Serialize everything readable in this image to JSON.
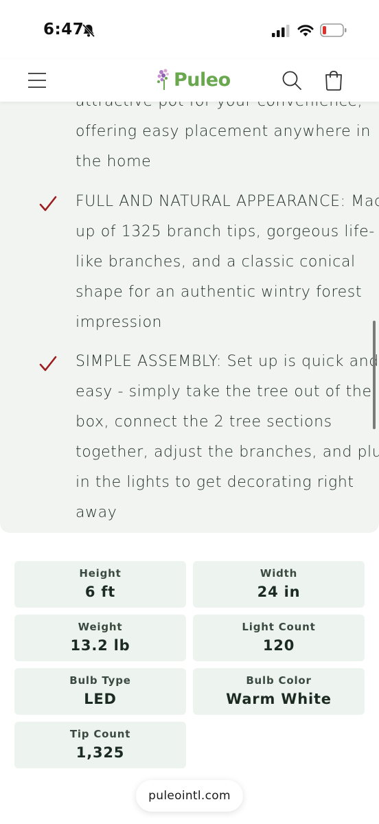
{
  "status_bar": {
    "time": "6:47"
  },
  "header": {
    "logo_text": "Puleo",
    "icons": [
      "menu-icon",
      "search-icon",
      "cart-icon"
    ]
  },
  "description": {
    "partial_lines": [
      "attractive pot for your convenience,",
      "offering easy placement anywhere in",
      "the home"
    ],
    "features": [
      {
        "lines": [
          "FULL AND NATURAL APPEARANCE: Made",
          "up of 1325 branch tips, gorgeous life-",
          "like branches, and a classic conical",
          "shape for an authentic wintry forest",
          "impression"
        ]
      },
      {
        "lines": [
          "SIMPLE ASSEMBLY: Set up is quick and",
          "easy - simply take the tree out of the",
          "box, connect the 2 tree sections",
          "together, adjust the branches, and plug",
          "in the lights to get decorating right",
          "away"
        ]
      }
    ]
  },
  "specs": [
    {
      "label": "Height",
      "value": "6 ft"
    },
    {
      "label": "Width",
      "value": "24 in"
    },
    {
      "label": "Weight",
      "value": "13.2 lb"
    },
    {
      "label": "Light Count",
      "value": "120"
    },
    {
      "label": "Bulb Type",
      "value": "LED"
    },
    {
      "label": "Bulb Color",
      "value": "Warm White"
    },
    {
      "label": "Tip Count",
      "value": "1,325"
    }
  ],
  "browser": {
    "url": "puleointl.com"
  },
  "colors": {
    "check": "#9b1c1c",
    "logo_green": "#6aa84f",
    "panel_bg": "#f2f4f2",
    "spec_bg": "#edf3ee"
  }
}
